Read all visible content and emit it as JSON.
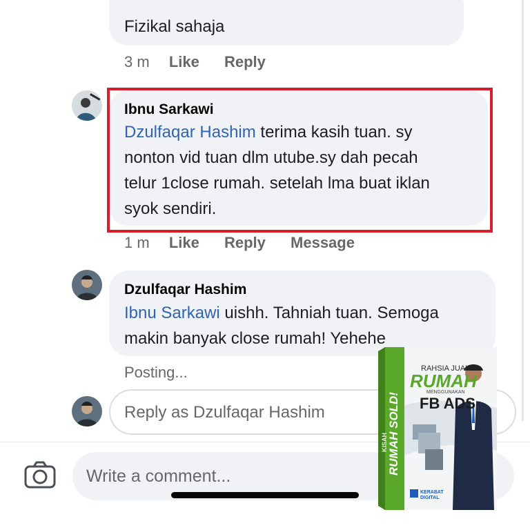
{
  "comments": [
    {
      "text": "Fizikal sahaja",
      "time": "3 m",
      "like": "Like",
      "reply": "Reply"
    },
    {
      "author": "Ibnu Sarkawi",
      "mention": "Dzulfaqar Hashim",
      "lines": [
        " terima kasih tuan. sy",
        "nonton vid tuan dlm utube.sy dah pecah",
        "telur 1close rumah. setelah lma buat iklan",
        "syok sendiri."
      ],
      "time": "1 m",
      "like": "Like",
      "reply": "Reply",
      "message": "Message",
      "highlight_color": "#d71f2b"
    },
    {
      "author": "Dzulfaqar Hashim",
      "mention": "Ibnu Sarkawi",
      "lines": [
        " uishh. Tahniah tuan. Semoga",
        "makin banyak close rumah! Yehehe"
      ],
      "status": "Posting..."
    }
  ],
  "reply_input": {
    "placeholder": "Reply as Dzulfaqar Hashim"
  },
  "comment_input": {
    "placeholder": "Write a comment..."
  },
  "ad": {
    "spine_words": [
      "KISAH",
      "RUMAH SOLD!"
    ],
    "kicker": "RAHSIA JUAL",
    "title": "RUMAH",
    "subtitle": "MENGGUNAKAN",
    "title2": "FB ADS",
    "brand": "KERABAT DIGITAL",
    "accent": "#5aa82a"
  },
  "colors": {
    "link": "#2f63b5",
    "muted": "#65676b",
    "bubble": "#f0f2f5"
  }
}
